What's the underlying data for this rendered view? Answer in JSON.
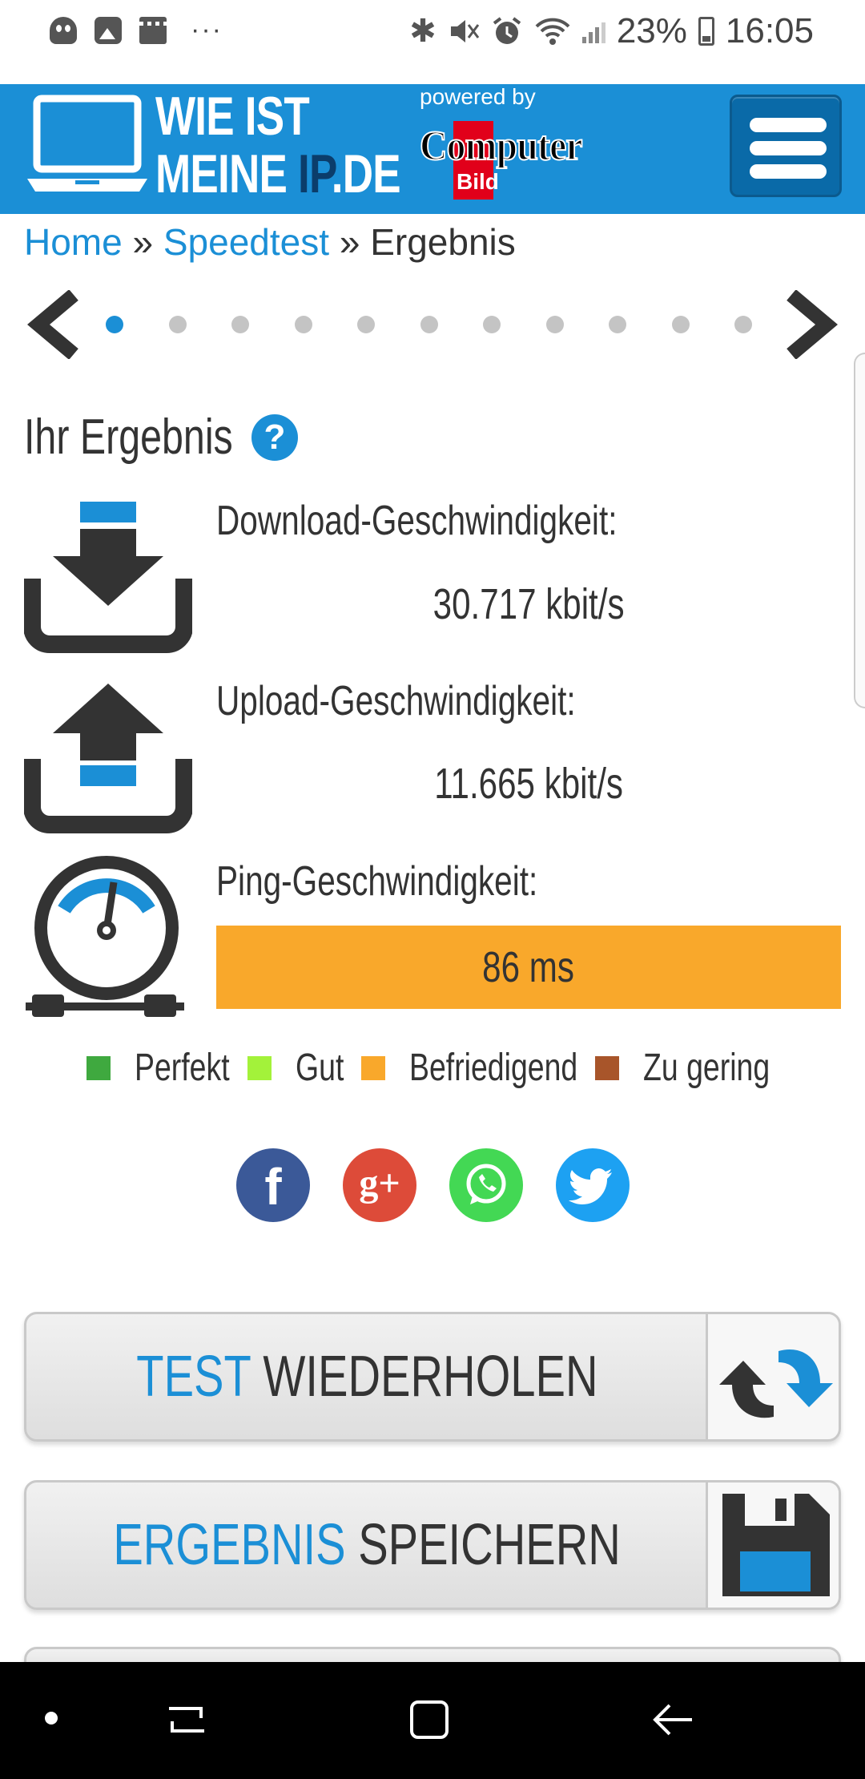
{
  "status_bar": {
    "battery": "23%",
    "time": "16:05",
    "overflow": "···"
  },
  "header": {
    "logo_line1": "WIE IST",
    "logo_line2_prefix": "MEINE ",
    "logo_line2_ip": "IP",
    "logo_line2_suffix": ".DE",
    "powered_by": "powered by",
    "partner_word": "Computer",
    "partner_sub": "Bild"
  },
  "breadcrumb": {
    "home": "Home",
    "sep1": "»",
    "speedtest": "Speedtest",
    "sep2": "»",
    "current": "Ergebnis"
  },
  "carousel": {
    "dot_count": 11,
    "active_index": 0
  },
  "result": {
    "title": "Ihr Ergebnis",
    "help": "?",
    "download_label": "Download-Geschwindigkeit:",
    "download_value": "30.717 kbit/s",
    "upload_label": "Upload-Geschwindigkeit:",
    "upload_value": "11.665 kbit/s",
    "ping_label": "Ping-Geschwindigkeit:",
    "ping_value": "86 ms",
    "ping_rating_color": "#f9a82b"
  },
  "legend": [
    {
      "label": "Perfekt",
      "color": "#3fa93f"
    },
    {
      "label": "Gut",
      "color": "#a3f23a"
    },
    {
      "label": "Befriedigend",
      "color": "#f9a82b"
    },
    {
      "label": "Zu gering",
      "color": "#a8552a"
    }
  ],
  "social": {
    "facebook": "f",
    "googleplus": "g+",
    "whatsapp": "whatsapp-icon",
    "twitter": "twitter-icon"
  },
  "actions": {
    "repeat_accent": "TEST",
    "repeat_rest": "WIEDERHOLEN",
    "save_accent": "ERGEBNIS",
    "save_rest": "SPEICHERN"
  },
  "colors": {
    "brand_blue": "#1b8fd6",
    "dark_icon": "#333333"
  }
}
